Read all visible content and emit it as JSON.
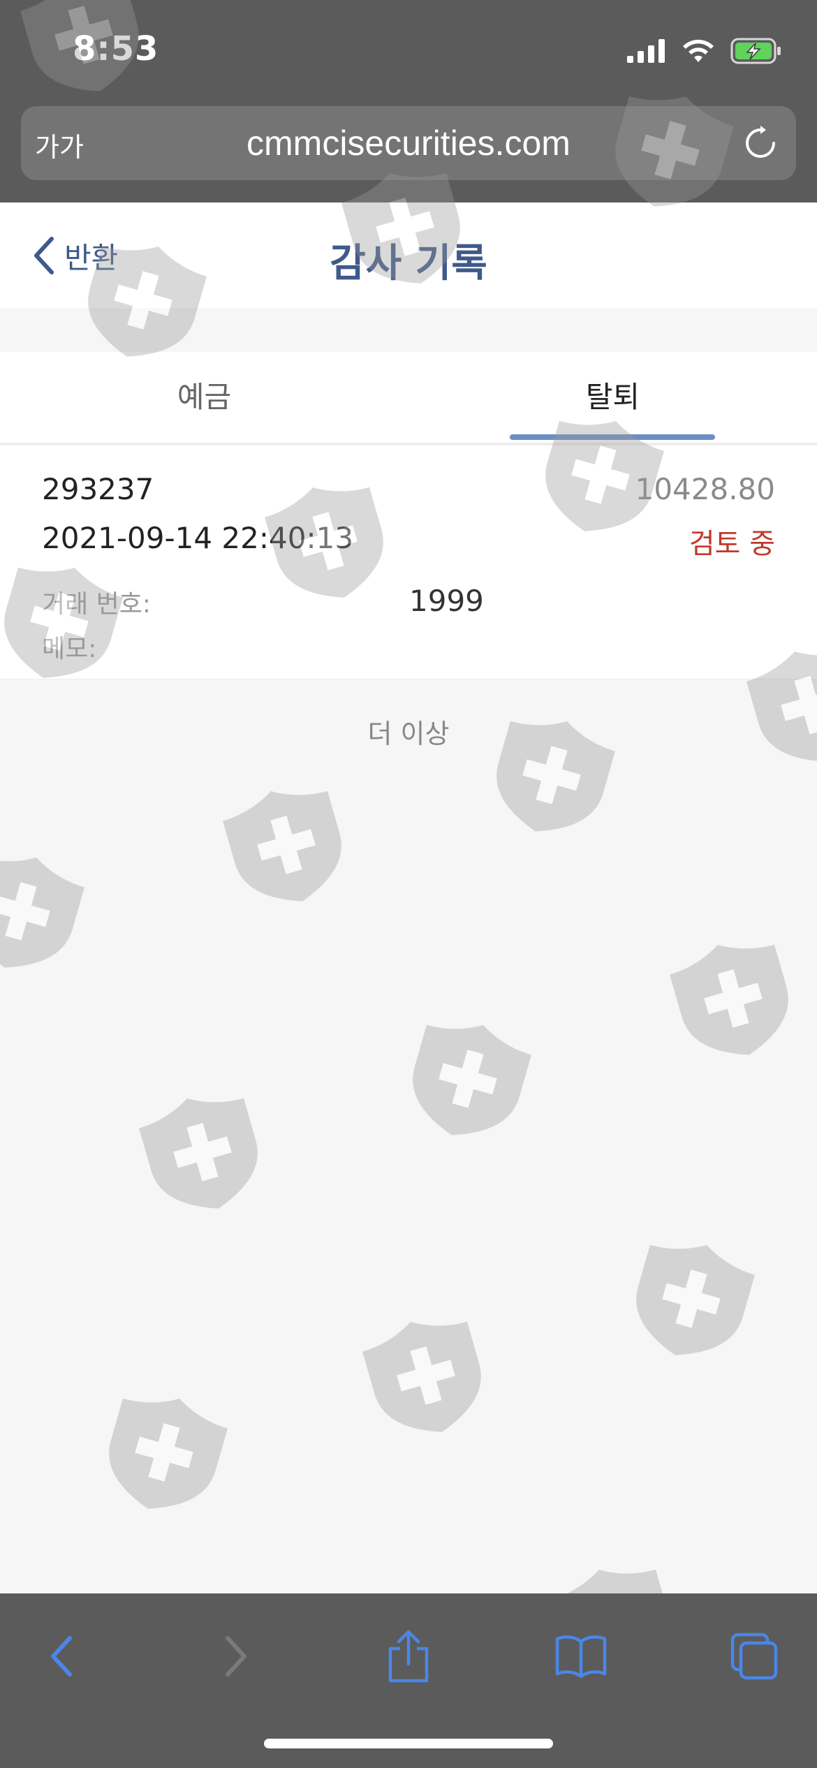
{
  "status_bar": {
    "time": "8:53"
  },
  "browser": {
    "text_size_label": "가가",
    "url": "cmmcisecurities.com"
  },
  "header": {
    "back_label": "반환",
    "title": "감사 기록"
  },
  "tabs": [
    {
      "label": "예금",
      "active": false
    },
    {
      "label": "탈퇴",
      "active": true
    }
  ],
  "record": {
    "id": "293237",
    "amount": "10428.80",
    "datetime": "2021-09-14 22:40:13",
    "status": "검토 중",
    "transaction_label": "거래 번호:",
    "transaction_value": "1999",
    "memo_label": "메모:"
  },
  "list_end": "더 이상",
  "colors": {
    "accent": "#3f5a8a",
    "tab_indicator": "#6b8fc4",
    "status_pending": "#c0392b",
    "toolbar_icon": "#4a86e8"
  },
  "icons": [
    "signal-icon",
    "wifi-icon",
    "battery-charging-icon",
    "reload-icon",
    "chevron-left-icon",
    "back-icon",
    "forward-icon",
    "share-icon",
    "bookmarks-icon",
    "tabs-icon"
  ]
}
